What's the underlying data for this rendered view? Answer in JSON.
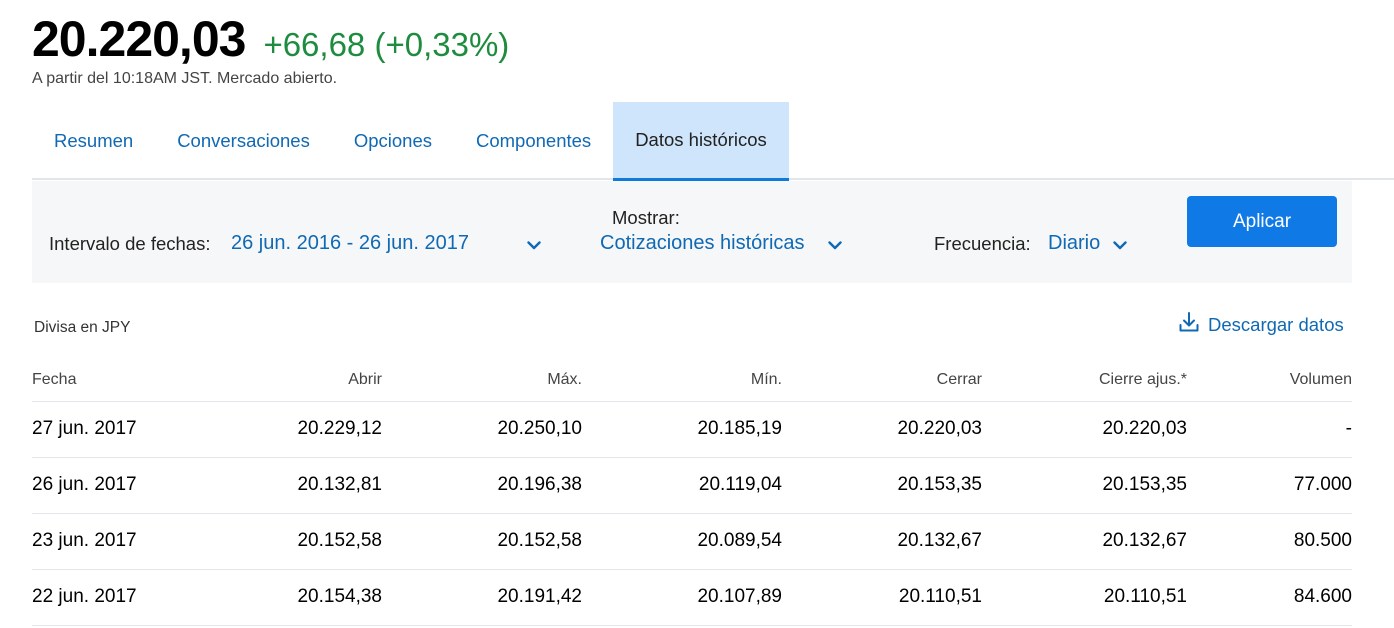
{
  "quote": {
    "price": "20.220,03",
    "change": "+66,68 (+0,33%)",
    "as_of": "A partir del 10:18AM JST. Mercado abierto."
  },
  "tabs": [
    {
      "label": "Resumen",
      "active": false
    },
    {
      "label": "Conversaciones",
      "active": false
    },
    {
      "label": "Opciones",
      "active": false
    },
    {
      "label": "Componentes",
      "active": false
    },
    {
      "label": "Datos históricos",
      "active": true
    }
  ],
  "filters": {
    "date_range_label": "Intervalo de fechas:",
    "date_range_value": "26 jun. 2016 - 26 jun. 2017",
    "show_label": "Mostrar:",
    "show_value": "Cotizaciones históricas",
    "frequency_label": "Frecuencia:",
    "frequency_value": "Diario",
    "apply_label": "Aplicar"
  },
  "currency_note": "Divisa en JPY",
  "download_label": "Descargar datos",
  "table": {
    "headers": [
      "Fecha",
      "Abrir",
      "Máx.",
      "Mín.",
      "Cerrar",
      "Cierre ajus.*",
      "Volumen"
    ],
    "rows": [
      [
        "27 jun. 2017",
        "20.229,12",
        "20.250,10",
        "20.185,19",
        "20.220,03",
        "20.220,03",
        "-"
      ],
      [
        "26 jun. 2017",
        "20.132,81",
        "20.196,38",
        "20.119,04",
        "20.153,35",
        "20.153,35",
        "77.000"
      ],
      [
        "23 jun. 2017",
        "20.152,58",
        "20.152,58",
        "20.089,54",
        "20.132,67",
        "20.132,67",
        "80.500"
      ],
      [
        "22 jun. 2017",
        "20.154,38",
        "20.191,42",
        "20.107,89",
        "20.110,51",
        "20.110,51",
        "84.600"
      ]
    ]
  },
  "colors": {
    "accent_blue": "#0f69b4",
    "button_blue": "#0f7ae5",
    "positive_green": "#1e8c3f",
    "active_tab_bg": "#cfe5fb"
  },
  "icons": {
    "chevron": "chevron-down-icon",
    "download": "download-icon"
  }
}
